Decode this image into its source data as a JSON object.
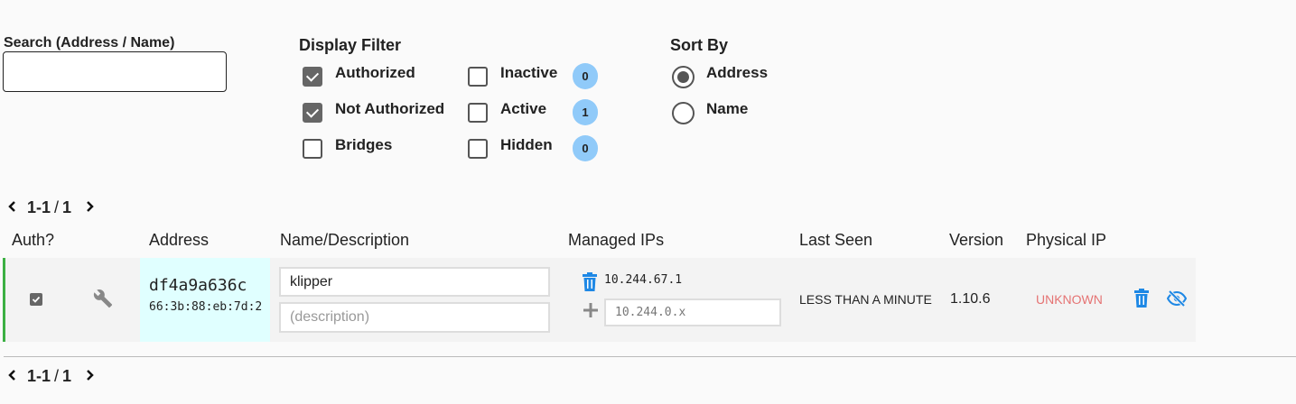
{
  "search": {
    "label": "Search (Address / Name)",
    "value": "",
    "placeholder": ""
  },
  "display_filter": {
    "title": "Display Filter",
    "options": [
      {
        "label": "Authorized",
        "checked": true
      },
      {
        "label": "Not Authorized",
        "checked": true
      },
      {
        "label": "Bridges",
        "checked": false
      },
      {
        "label": "Inactive",
        "checked": false,
        "count": "0"
      },
      {
        "label": "Active",
        "checked": false,
        "count": "1"
      },
      {
        "label": "Hidden",
        "checked": false,
        "count": "0"
      }
    ]
  },
  "sort_by": {
    "title": "Sort By",
    "options": [
      {
        "label": "Address",
        "selected": true
      },
      {
        "label": "Name",
        "selected": false
      }
    ]
  },
  "pager": {
    "prev_icon": "chevron-left-icon",
    "next_icon": "chevron-right-icon",
    "range": "1-1",
    "separator": "/",
    "total": "1"
  },
  "table": {
    "headers": {
      "auth": "Auth?",
      "address": "Address",
      "name": "Name/Description",
      "managed_ips": "Managed IPs",
      "last_seen": "Last Seen",
      "version": "Version",
      "physical_ip": "Physical IP"
    },
    "rows": [
      {
        "authorized": true,
        "address": "df4a9a636c",
        "mac": "66:3b:88:eb:7d:2",
        "name": "klipper",
        "description_placeholder": "(description)",
        "managed_ip": "10.244.67.1",
        "new_ip_placeholder": "10.244.0.x",
        "last_seen": "LESS THAN A MINUTE",
        "version": "1.10.6",
        "physical_ip": "UNKNOWN"
      }
    ]
  },
  "colors": {
    "accent": "#1e88e5",
    "badge": "#90caf9",
    "authorized_border": "#3cb043",
    "address_bg": "#e0ffff",
    "unknown": "#e57373"
  }
}
